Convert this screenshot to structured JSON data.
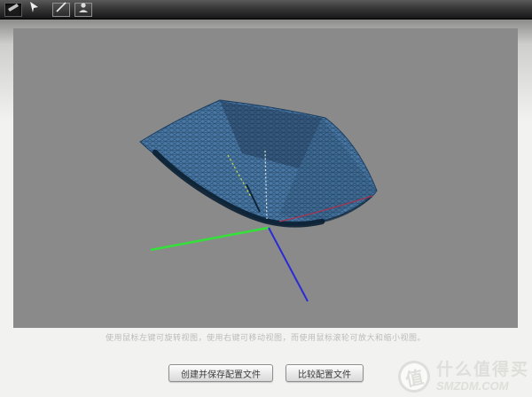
{
  "toolbar": {
    "icons": [
      {
        "name": "plane-tool"
      },
      {
        "name": "cursor-tool"
      },
      {
        "name": "line-tool"
      },
      {
        "name": "portrait-tool"
      }
    ]
  },
  "viewer": {
    "help_text": "使用鼠标左键可旋转视图，使用右键可移动视图，而使用鼠标滚轮可放大和缩小视图。"
  },
  "buttons": {
    "create_save": "创建并保存配置文件",
    "compare": "比较配置文件"
  },
  "watermark": {
    "logo_char": "值",
    "site_name": "什么值得买",
    "site_url": "SMZDM.COM"
  },
  "colors": {
    "canvas_bg": "#8a8a8a",
    "mesh_fill": "#4a78a4",
    "mesh_wire": "#14304e",
    "mesh_edge": "#1d3f63",
    "mesh_rim": "#0b2133",
    "axis_green": "#35e03a",
    "axis_blue": "#2b2bd6",
    "profile_line": "#a33553",
    "dash_white": "#e0e0e0",
    "dash_yellow": "#b8cf52"
  }
}
